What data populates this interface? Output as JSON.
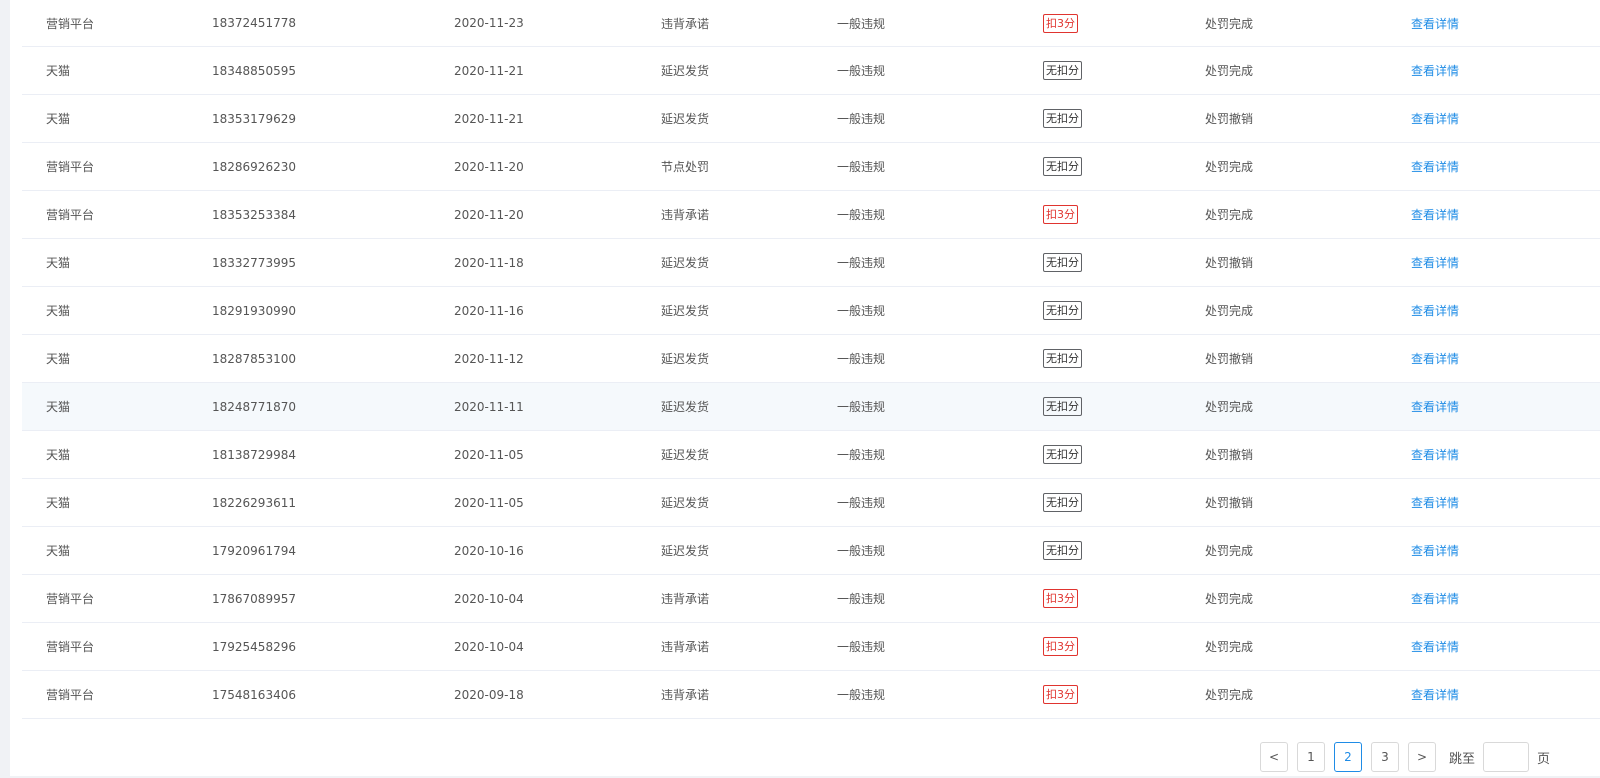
{
  "rows": [
    {
      "platform": "营销平台",
      "phone": "18372451778",
      "date": "2020-11-23",
      "reason": "违背承诺",
      "level": "一般违规",
      "score": "扣3分",
      "deduct": true,
      "status": "处罚完成",
      "action": "查看详情"
    },
    {
      "platform": "天猫",
      "phone": "18348850595",
      "date": "2020-11-21",
      "reason": "延迟发货",
      "level": "一般违规",
      "score": "无扣分",
      "deduct": false,
      "status": "处罚完成",
      "action": "查看详情"
    },
    {
      "platform": "天猫",
      "phone": "18353179629",
      "date": "2020-11-21",
      "reason": "延迟发货",
      "level": "一般违规",
      "score": "无扣分",
      "deduct": false,
      "status": "处罚撤销",
      "action": "查看详情"
    },
    {
      "platform": "营销平台",
      "phone": "18286926230",
      "date": "2020-11-20",
      "reason": "节点处罚",
      "level": "一般违规",
      "score": "无扣分",
      "deduct": false,
      "status": "处罚完成",
      "action": "查看详情"
    },
    {
      "platform": "营销平台",
      "phone": "18353253384",
      "date": "2020-11-20",
      "reason": "违背承诺",
      "level": "一般违规",
      "score": "扣3分",
      "deduct": true,
      "status": "处罚完成",
      "action": "查看详情"
    },
    {
      "platform": "天猫",
      "phone": "18332773995",
      "date": "2020-11-18",
      "reason": "延迟发货",
      "level": "一般违规",
      "score": "无扣分",
      "deduct": false,
      "status": "处罚撤销",
      "action": "查看详情"
    },
    {
      "platform": "天猫",
      "phone": "18291930990",
      "date": "2020-11-16",
      "reason": "延迟发货",
      "level": "一般违规",
      "score": "无扣分",
      "deduct": false,
      "status": "处罚完成",
      "action": "查看详情"
    },
    {
      "platform": "天猫",
      "phone": "18287853100",
      "date": "2020-11-12",
      "reason": "延迟发货",
      "level": "一般违规",
      "score": "无扣分",
      "deduct": false,
      "status": "处罚撤销",
      "action": "查看详情"
    },
    {
      "platform": "天猫",
      "phone": "18248771870",
      "date": "2020-11-11",
      "reason": "延迟发货",
      "level": "一般违规",
      "score": "无扣分",
      "deduct": false,
      "status": "处罚完成",
      "action": "查看详情"
    },
    {
      "platform": "天猫",
      "phone": "18138729984",
      "date": "2020-11-05",
      "reason": "延迟发货",
      "level": "一般违规",
      "score": "无扣分",
      "deduct": false,
      "status": "处罚撤销",
      "action": "查看详情"
    },
    {
      "platform": "天猫",
      "phone": "18226293611",
      "date": "2020-11-05",
      "reason": "延迟发货",
      "level": "一般违规",
      "score": "无扣分",
      "deduct": false,
      "status": "处罚撤销",
      "action": "查看详情"
    },
    {
      "platform": "天猫",
      "phone": "17920961794",
      "date": "2020-10-16",
      "reason": "延迟发货",
      "level": "一般违规",
      "score": "无扣分",
      "deduct": false,
      "status": "处罚完成",
      "action": "查看详情"
    },
    {
      "platform": "营销平台",
      "phone": "17867089957",
      "date": "2020-10-04",
      "reason": "违背承诺",
      "level": "一般违规",
      "score": "扣3分",
      "deduct": true,
      "status": "处罚完成",
      "action": "查看详情"
    },
    {
      "platform": "营销平台",
      "phone": "17925458296",
      "date": "2020-10-04",
      "reason": "违背承诺",
      "level": "一般违规",
      "score": "扣3分",
      "deduct": true,
      "status": "处罚完成",
      "action": "查看详情"
    },
    {
      "platform": "营销平台",
      "phone": "17548163406",
      "date": "2020-09-18",
      "reason": "违背承诺",
      "level": "一般违规",
      "score": "扣3分",
      "deduct": true,
      "status": "处罚完成",
      "action": "查看详情"
    }
  ],
  "highlighted_row": 8,
  "colors": {
    "deduct_tag": "#e0342f",
    "link": "#1f8ce6",
    "active_page": "#1f8ce6",
    "hover_row": "#f5f9fc"
  },
  "pagination": {
    "prev_icon": "chevron-left-icon",
    "prev_glyph": "<",
    "pages": [
      "1",
      "2",
      "3"
    ],
    "current_page": "2",
    "next_icon": "chevron-right-icon",
    "next_glyph": ">",
    "jump_label": "跳至",
    "jump_value": "",
    "page_suffix": "页"
  }
}
